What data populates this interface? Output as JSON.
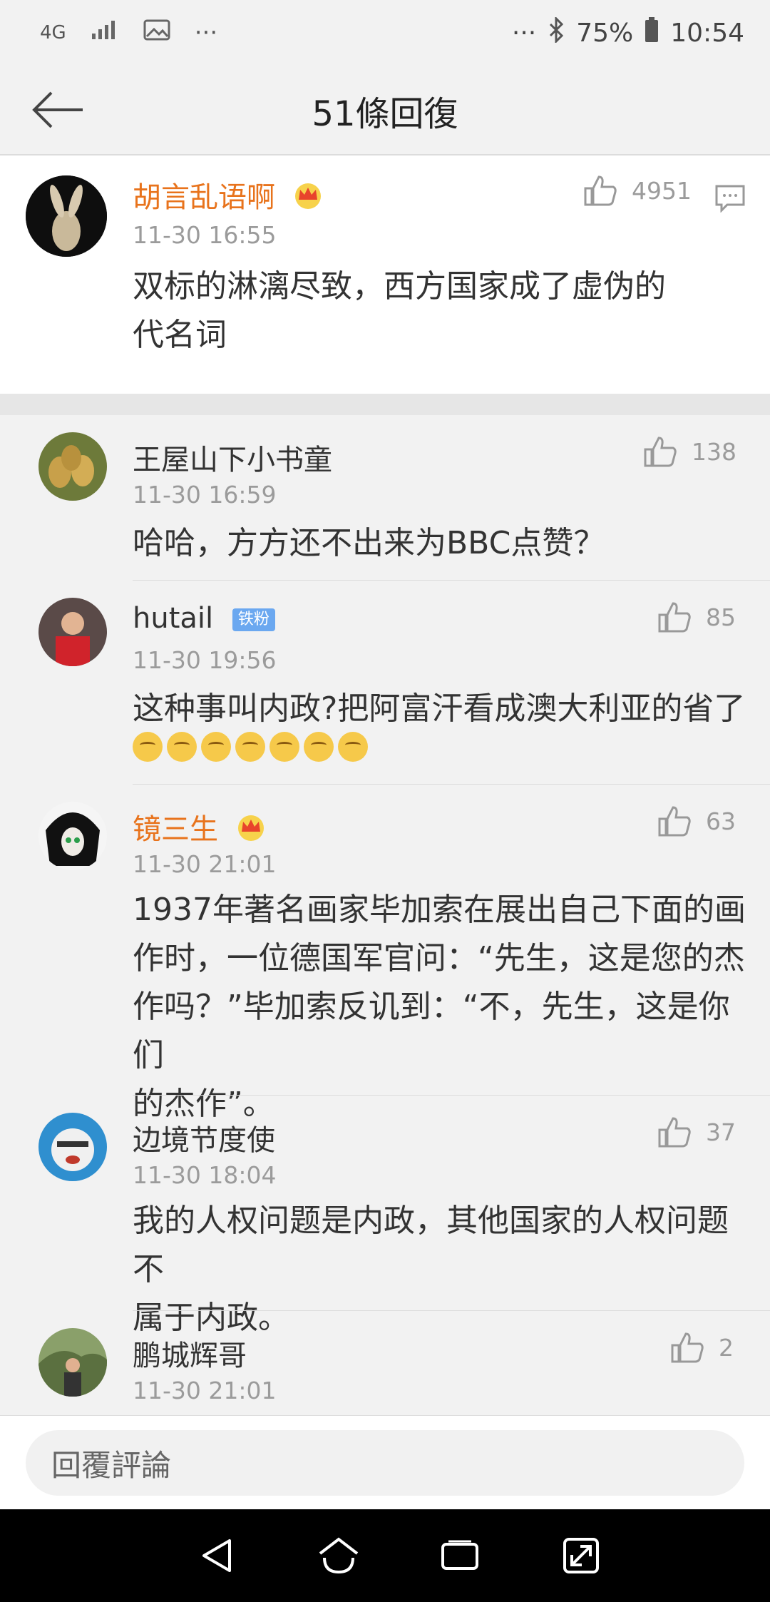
{
  "status_bar": {
    "network": "4G",
    "battery": "75%",
    "time": "10:54",
    "icons": [
      "signal-icon",
      "image-icon",
      "more-icon",
      "bluetooth-icon",
      "battery-icon"
    ]
  },
  "header": {
    "title": "51條回復"
  },
  "main_post": {
    "username": "胡言乱语啊",
    "time": "11-30 16:55",
    "likes": "4951",
    "content_line1": "双标的淋漓尽致，西方国家成了虚伪的",
    "content_line2": "代名词"
  },
  "replies": [
    {
      "username": "王屋山下小书童",
      "time": "11-30 16:59",
      "likes": "138",
      "content": "哈哈，方方还不出来为BBC点赞？"
    },
    {
      "username": "hutail",
      "badge": "铁粉",
      "time": "11-30 19:56",
      "likes": "85",
      "content": "这种事叫内政?把阿富汗看成澳大利亚的省了"
    },
    {
      "username": "镜三生",
      "time": "11-30 21:01",
      "likes": "63",
      "content_line1": "1937年著名画家毕加索在展出自己下面的画",
      "content_line2": "作时，一位德国军官问：“先生，这是您的杰",
      "content_line3": "作吗？”毕加索反讥到：“不，先生，这是你们",
      "content_line4": "的杰作”。"
    },
    {
      "username": "边境节度使",
      "time": "11-30 18:04",
      "likes": "37",
      "content_line1": "我的人权问题是内政，其他国家的人权问题不",
      "content_line2": "属于内政。"
    },
    {
      "username": "鹏城辉哥",
      "time": "11-30 21:01",
      "likes": "2"
    }
  ],
  "reply_input": {
    "placeholder": "回覆評論"
  },
  "colors": {
    "vip_name": "#e8731c",
    "badge": "#6ba8f0",
    "background": "#f2f2f2"
  }
}
